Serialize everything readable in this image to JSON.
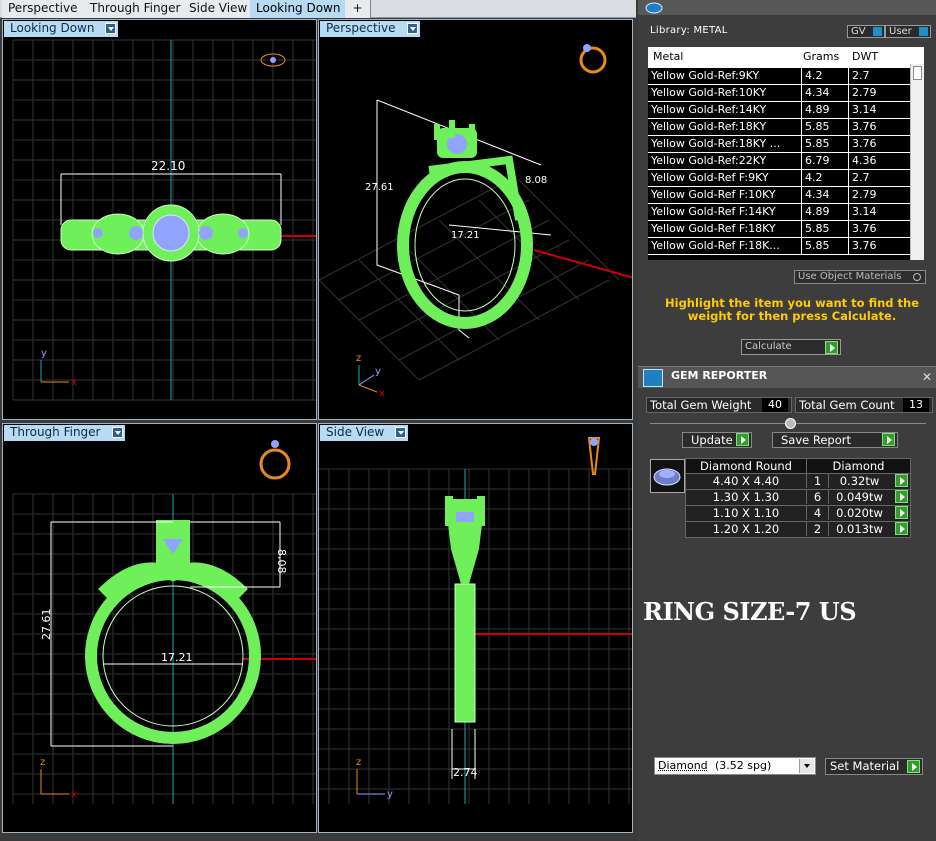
{
  "tabs": [
    "Perspective",
    "Through Finger",
    "Side View",
    "Looking Down",
    "+"
  ],
  "viewports": {
    "top_left": {
      "label": "Looking Down",
      "dim_width": "22.10",
      "axis_y": "y",
      "axis_x": "x"
    },
    "top_right": {
      "label": "Perspective",
      "dim_height": "27.61",
      "dim_top": "8.08",
      "dim_width": "17.21",
      "axis_z": "z",
      "axis_y": "y",
      "axis_x": "x"
    },
    "bottom_left": {
      "label": "Through Finger",
      "dim_height": "27.61",
      "dim_top": "8.08",
      "dim_width": "17.21",
      "axis_z": "z",
      "axis_x": "x"
    },
    "bottom_right": {
      "label": "Side View",
      "dim_width": "2.74",
      "axis_z": "z",
      "axis_y": "y"
    }
  },
  "library": {
    "title": "Library: METAL",
    "gv_label": "GV",
    "user_label": "User",
    "columns": [
      "Metal",
      "Grams",
      "DWT"
    ],
    "rows": [
      [
        "Yellow Gold-Ref:9KY",
        "4.2",
        "2.7"
      ],
      [
        "Yellow Gold-Ref:10KY",
        "4.34",
        "2.79"
      ],
      [
        "Yellow Gold-Ref:14KY",
        "4.89",
        "3.14"
      ],
      [
        "Yellow Gold-Ref:18KY",
        "5.85",
        "3.76"
      ],
      [
        "Yellow Gold-Ref:18KY ...",
        "5.85",
        "3.76"
      ],
      [
        "Yellow Gold-Ref:22KY",
        "6.79",
        "4.36"
      ],
      [
        "Yellow Gold-Ref F:9KY",
        "4.2",
        "2.7"
      ],
      [
        "Yellow Gold-Ref F:10KY",
        "4.34",
        "2.79"
      ],
      [
        "Yellow Gold-Ref F:14KY",
        "4.89",
        "3.14"
      ],
      [
        "Yellow Gold-Ref F:18KY",
        "5.85",
        "3.76"
      ],
      [
        "Yellow Gold-Ref F:18K...",
        "5.85",
        "3.76"
      ]
    ],
    "use_object_materials": "Use Object Materials",
    "hint": "Highlight the item you want to find the weight for then press Calculate.",
    "calculate": "Calculate"
  },
  "gem_reporter": {
    "title": "GEM REPORTER",
    "total_weight_label": "Total Gem Weight",
    "total_weight": "40",
    "total_count_label": "Total Gem Count",
    "total_count": "13",
    "update": "Update",
    "save_report": "Save Report",
    "table_head": [
      "Diamond Round",
      "Diamond"
    ],
    "rows": [
      [
        "4.40 X 4.40",
        "1",
        "0.32tw"
      ],
      [
        "1.30 X 1.30",
        "6",
        "0.049tw"
      ],
      [
        "1.10 X 1.10",
        "4",
        "0.020tw"
      ],
      [
        "1.20 X 1.20",
        "2",
        "0.013tw"
      ]
    ]
  },
  "ring_size": "RING SIZE-7 US",
  "material_select": {
    "name": "Diamond",
    "value": "(3.52 spg)"
  },
  "set_material": "Set Material",
  "colors": {
    "ring": "#7CFF5C",
    "gem": "#8fa3ff",
    "grid": "#3a3a3a",
    "accent": "#b8dbf4",
    "hint": "#ffcc00"
  }
}
